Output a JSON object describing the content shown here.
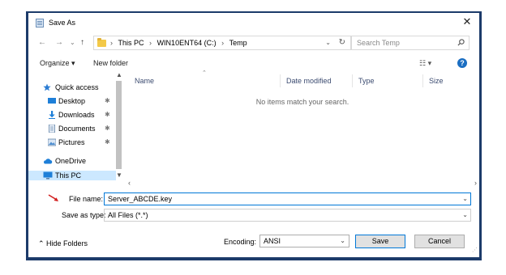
{
  "window": {
    "title": "Save As",
    "close_glyph": "✕"
  },
  "nav": {
    "back_glyph": "←",
    "forward_glyph": "→",
    "recent_glyph": "⌄",
    "up_glyph": "↑",
    "breadcrumbs": [
      "This PC",
      "WIN10ENT64 (C:)",
      "Temp"
    ],
    "separator": "›",
    "dropdown_glyph": "⌄",
    "refresh_glyph": "↻",
    "search_placeholder": "Search Temp"
  },
  "toolbar": {
    "organize_label": "Organize ▾",
    "new_folder_label": "New folder",
    "view_label": "☷ ▾",
    "help_glyph": "?"
  },
  "sidebar": {
    "items": [
      {
        "label": "Quick access",
        "icon": "star-icon",
        "pinned": false
      },
      {
        "label": "Desktop",
        "icon": "desktop-icon",
        "pinned": true
      },
      {
        "label": "Downloads",
        "icon": "download-icon",
        "pinned": true
      },
      {
        "label": "Documents",
        "icon": "documents-icon",
        "pinned": true
      },
      {
        "label": "Pictures",
        "icon": "pictures-icon",
        "pinned": true
      },
      {
        "label": "OneDrive",
        "icon": "cloud-icon",
        "pinned": false
      },
      {
        "label": "This PC",
        "icon": "computer-icon",
        "pinned": false,
        "selected": true
      }
    ],
    "pin_glyph": "✱"
  },
  "file_list": {
    "columns": [
      "Name",
      "Date modified",
      "Type",
      "Size"
    ],
    "empty_message": "No items match your search."
  },
  "form": {
    "file_name_label": "File name:",
    "file_name_value": "Server_ABCDE.key",
    "save_as_type_label": "Save as type:",
    "save_as_type_value": "All Files  (*.*)"
  },
  "footer": {
    "hide_folders_label": "⌃  Hide Folders",
    "encoding_label": "Encoding:",
    "encoding_value": "ANSI",
    "save_label": "Save",
    "cancel_label": "Cancel"
  },
  "colors": {
    "accent": "#0078d7",
    "selection": "#cce8ff",
    "frame": "#1c3b6a",
    "annotation_arrow": "#d21f1f"
  }
}
